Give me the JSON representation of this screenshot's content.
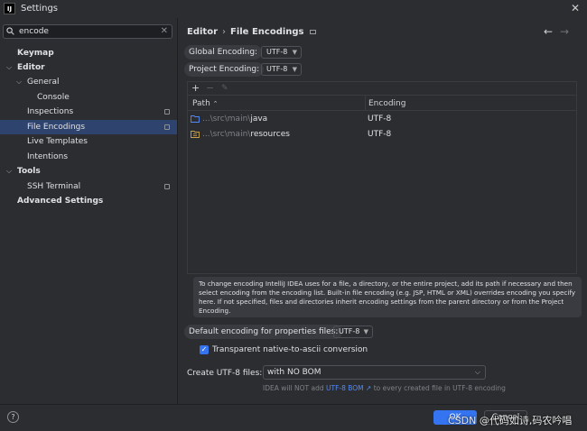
{
  "window": {
    "title": "Settings",
    "logo_text": "IJ"
  },
  "search": {
    "value": "encode"
  },
  "sidebar": {
    "items": [
      {
        "label": "Keymap",
        "level": 0
      },
      {
        "label": "Editor",
        "level": 0,
        "expanded": true
      },
      {
        "label": "General",
        "level": 1,
        "expanded": true
      },
      {
        "label": "Console",
        "level": 2
      },
      {
        "label": "Inspections",
        "level": 1
      },
      {
        "label": "File Encodings",
        "level": 1,
        "selected": true
      },
      {
        "label": "Live Templates",
        "level": 1
      },
      {
        "label": "Intentions",
        "level": 1
      },
      {
        "label": "Tools",
        "level": 0,
        "expanded": true
      },
      {
        "label": "SSH Terminal",
        "level": 1
      },
      {
        "label": "Advanced Settings",
        "level": 0
      }
    ]
  },
  "breadcrumb": {
    "parent": "Editor",
    "current": "File Encodings"
  },
  "global_encoding": {
    "label": "Global Encoding:",
    "value": "UTF-8"
  },
  "project_encoding": {
    "label": "Project Encoding:",
    "value": "UTF-8"
  },
  "table": {
    "headers": {
      "path": "Path",
      "encoding": "Encoding"
    },
    "rows": [
      {
        "path_dim": "...\\src\\main\\",
        "path_main": "java",
        "encoding": "UTF-8",
        "icon": "folder-icon"
      },
      {
        "path_dim": "...\\src\\main\\",
        "path_main": "resources",
        "encoding": "UTF-8",
        "icon": "resources-folder-icon"
      }
    ]
  },
  "info_text": "To change encoding IntelliJ IDEA uses for a file, a directory, or the entire project, add its path if necessary and then select encoding from the encoding list. Built-in file encoding (e.g. JSP, HTML or XML) overrides encoding you specify here. If not specified, files and directories inherit encoding settings from the parent directory or from the Project Encoding.",
  "properties_encoding": {
    "label": "Default encoding for properties files:",
    "value": "UTF-8"
  },
  "transparent_ascii": {
    "label": "Transparent native-to-ascii conversion",
    "checked": true
  },
  "bom": {
    "label": "Create UTF-8 files:",
    "value": "with NO BOM",
    "hint_before": "IDEA will NOT add ",
    "hint_link": "UTF-8 BOM ↗",
    "hint_after": " to every created file in UTF-8 encoding"
  },
  "buttons": {
    "ok": "OK",
    "cancel": "Cancel",
    "help": "?"
  },
  "watermark": "CSDN @代码如诗,码农吟唱",
  "colors": {
    "accent": "#3574f0",
    "selection": "#2e436e",
    "link": "#548af7"
  }
}
